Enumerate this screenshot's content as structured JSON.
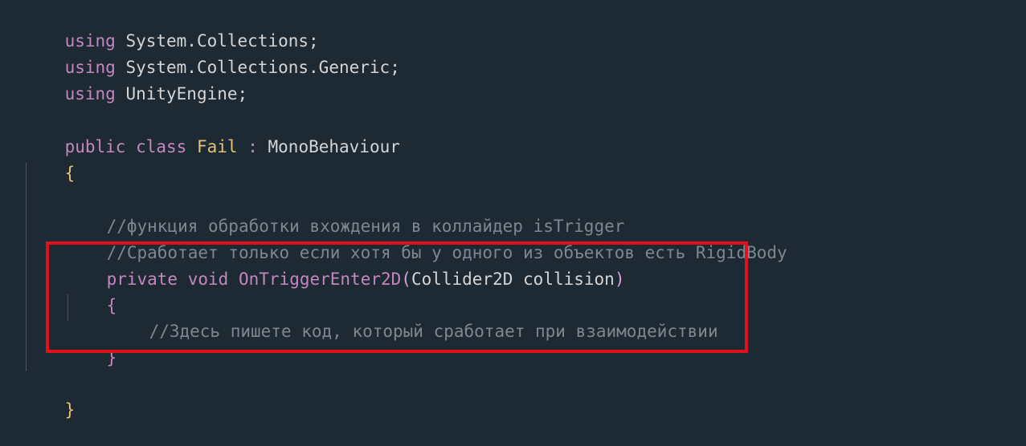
{
  "code": {
    "line1": {
      "kw": "using",
      "ns": "System.Collections",
      "semi": ";"
    },
    "line2": {
      "kw": "using",
      "ns": "System.Collections.Generic",
      "semi": ";"
    },
    "line3": {
      "kw": "using",
      "ns": "UnityEngine",
      "semi": ";"
    },
    "class_line": {
      "public": "public",
      "class": "class",
      "name": "Fail",
      "colon": ":",
      "base": "MonoBehaviour"
    },
    "open_brace": "{",
    "comment1": "//функция обработки вхождения в коллайдер isTrigger",
    "comment2": "//Сработает только если хотя бы у одного из объектов есть RigidBody",
    "method_line": {
      "private": "private",
      "void": "void",
      "name": "OnTriggerEnter2D",
      "open_paren": "(",
      "param_type": "Collider2D",
      "param_name": "collision",
      "close_paren": ")"
    },
    "method_open": "{",
    "method_comment": "//Здесь пишете код, который сработает при взаимодействии",
    "method_close": "}",
    "close_brace": "}"
  },
  "colors": {
    "background": "#1e2a33",
    "keyword": "#c586c0",
    "class_name": "#e5c07b",
    "comment": "#7c8791",
    "highlight_border": "#e0101c"
  }
}
